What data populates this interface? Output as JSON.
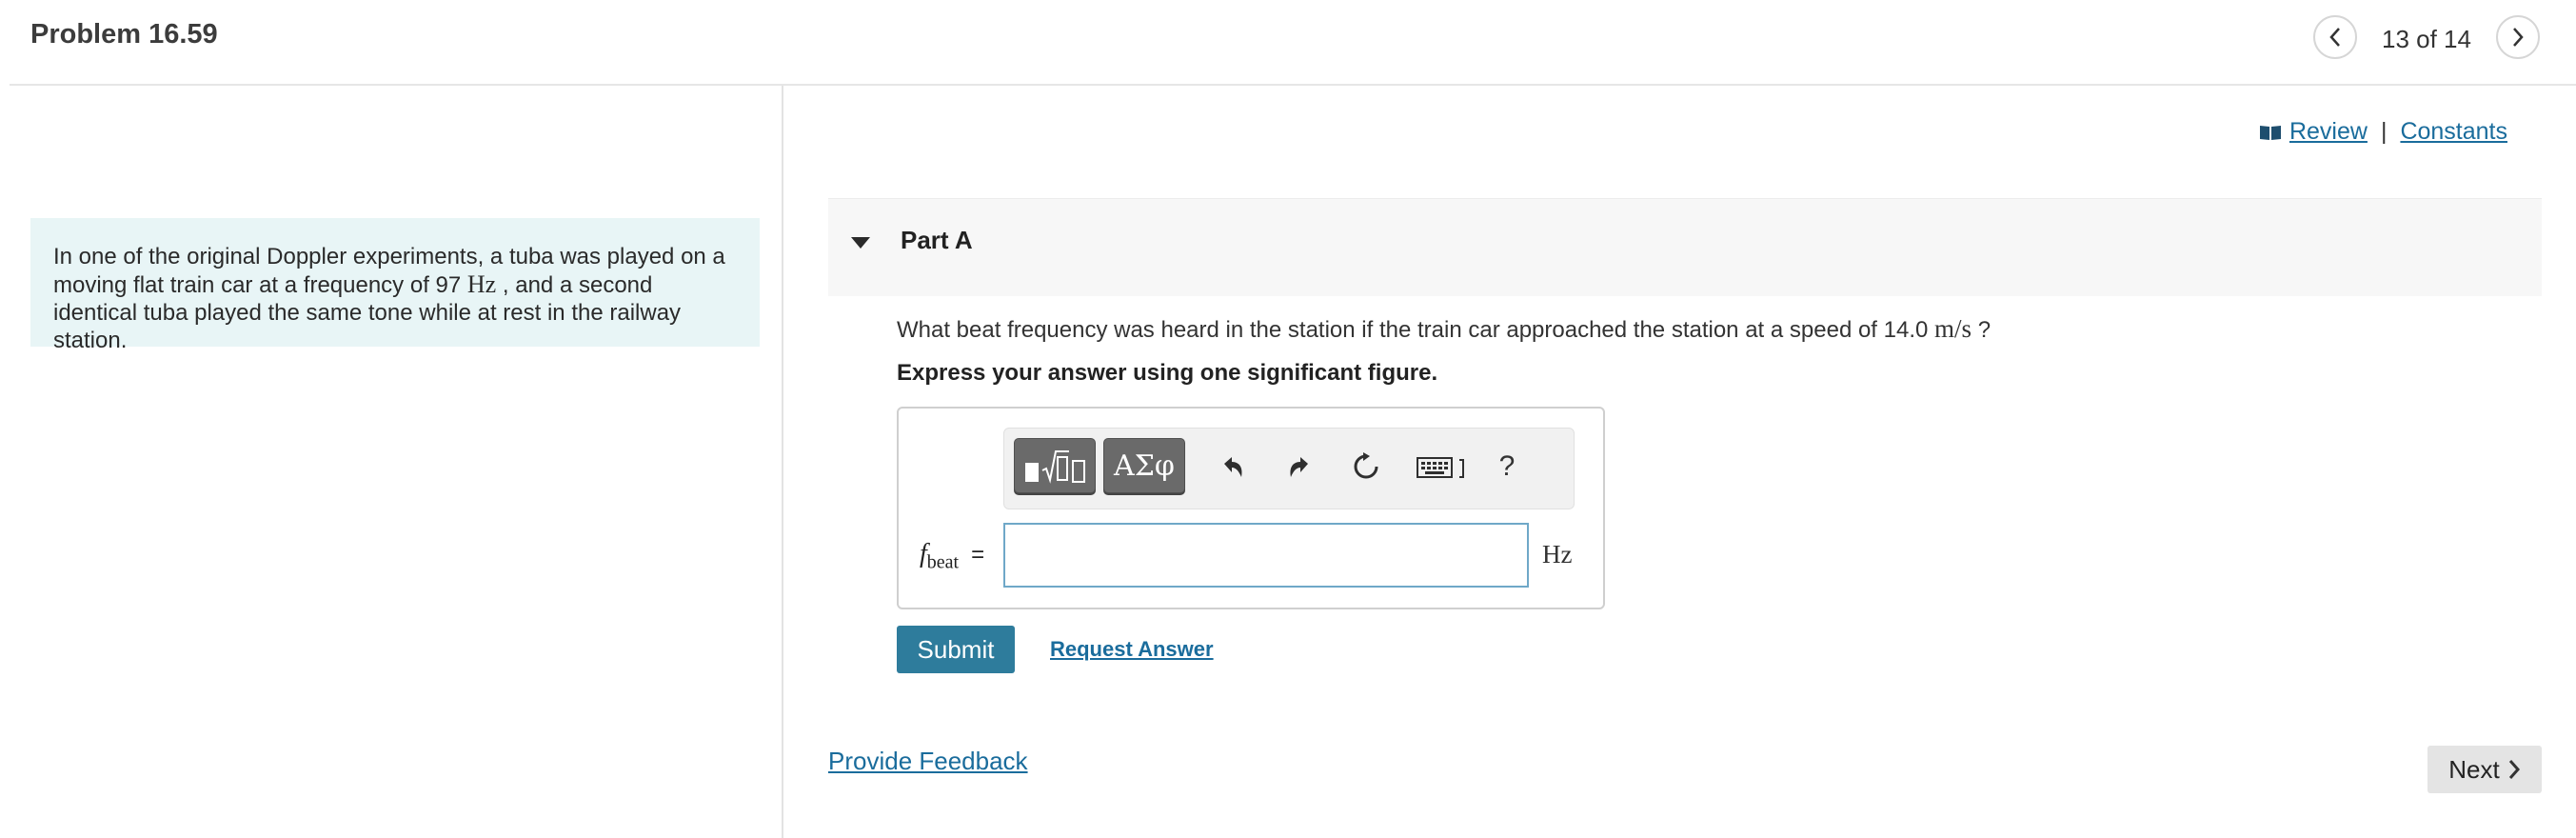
{
  "header": {
    "title": "Problem 16.59",
    "page_count": "13 of 14",
    "prev_icon": "chevron-left-icon",
    "next_icon": "chevron-right-icon"
  },
  "intro": {
    "text_a": "In one of the original Doppler experiments, a tuba was played on a moving flat train car at a frequency of 97 ",
    "unit": "Hz",
    "text_b": " , and a second identical tuba played the same tone while at rest in the railway station."
  },
  "links": {
    "review": "Review",
    "separator": "|",
    "constants": "Constants"
  },
  "part": {
    "title": "Part A",
    "question_a": "What beat frequency was heard in the station if the train car approached the station at a speed of 14.0 ",
    "question_unit": "m/s",
    "question_b": " ?",
    "instruction": "Express your answer using one significant figure."
  },
  "toolbar": {
    "greek_label": "ΑΣφ",
    "help_label": "?"
  },
  "answer": {
    "variable": "f",
    "subscript": "beat",
    "equals": "=",
    "value": "",
    "unit": "Hz"
  },
  "actions": {
    "submit": "Submit",
    "request_answer": "Request Answer",
    "provide_feedback": "Provide Feedback",
    "next": "Next"
  },
  "colors": {
    "accent": "#2e7c9c",
    "link": "#1a6c9c",
    "intro_bg": "#e8f5f6"
  }
}
